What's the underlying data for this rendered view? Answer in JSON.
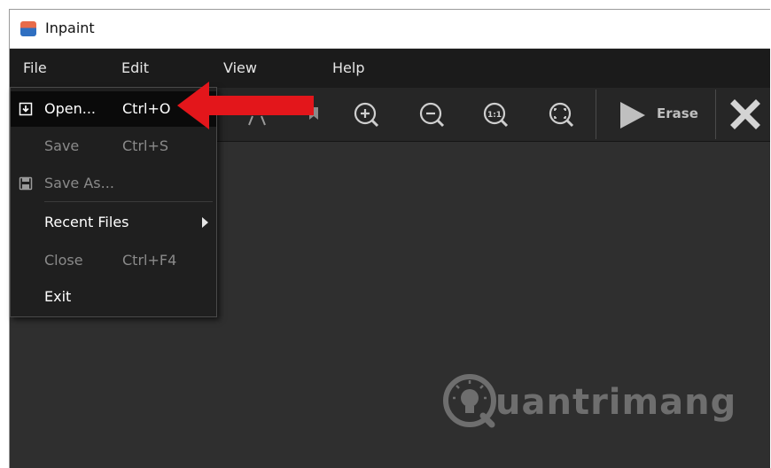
{
  "window": {
    "title": "Inpaint"
  },
  "menubar": {
    "file": "File",
    "edit": "Edit",
    "view": "View",
    "help": "Help"
  },
  "file_menu": {
    "open": {
      "label": "Open...",
      "shortcut": "Ctrl+O"
    },
    "save": {
      "label": "Save",
      "shortcut": "Ctrl+S"
    },
    "save_as": {
      "label": "Save As..."
    },
    "recent": {
      "label": "Recent Files"
    },
    "close": {
      "label": "Close",
      "shortcut": "Ctrl+F4"
    },
    "exit": {
      "label": "Exit"
    }
  },
  "toolbar": {
    "erase_label": "Erase",
    "zoom_actual_label": "1:1",
    "icons": [
      "zoom-in-icon",
      "zoom-out-icon",
      "zoom-actual-size-icon",
      "zoom-fit-icon",
      "play-icon",
      "close-icon"
    ]
  },
  "watermark": {
    "text": "uantrimang"
  },
  "colors": {
    "arrow": "#e3161b",
    "menubar": "#1b1b1b",
    "toolbar": "#262626",
    "canvas": "#2f2f2f"
  }
}
